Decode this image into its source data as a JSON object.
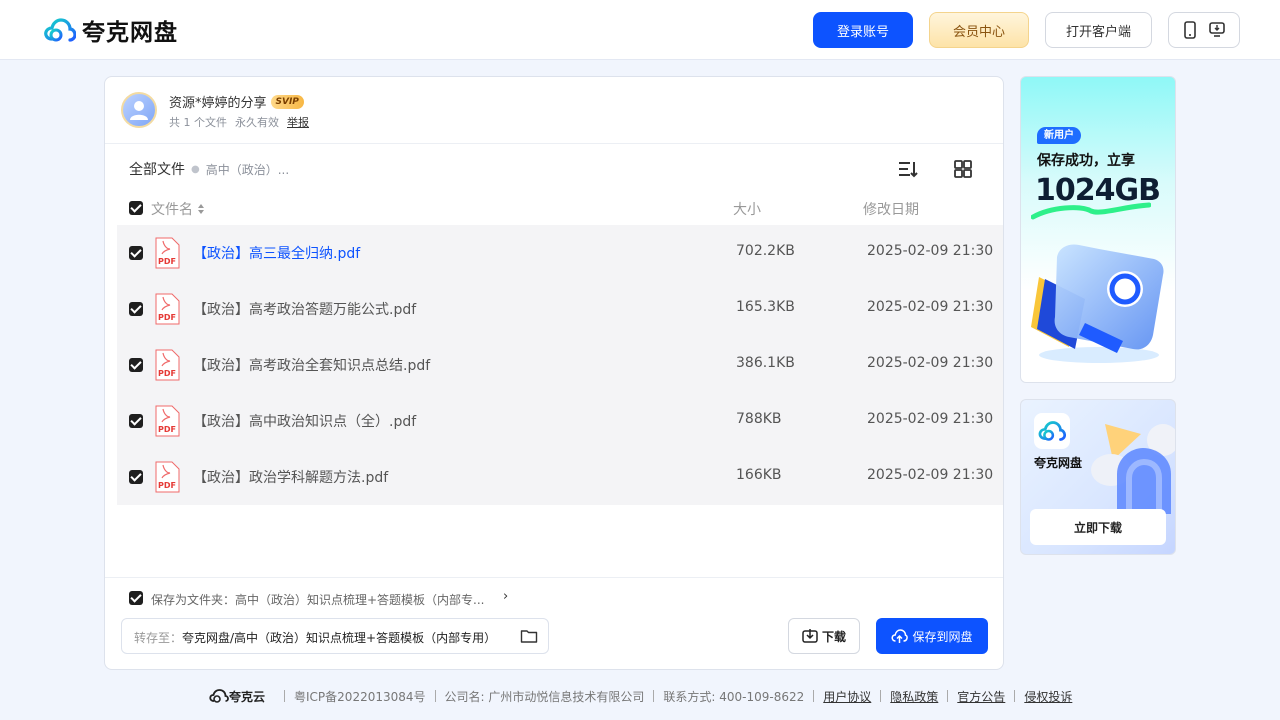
{
  "header": {
    "logo_text": "夸克网盘",
    "login_label": "登录账号",
    "vip_label": "会员中心",
    "client_label": "打开客户端"
  },
  "share": {
    "title": "资源*婷婷的分享",
    "badge": "SVIP",
    "file_count": "共 1 个文件",
    "validity": "永久有效",
    "report": "举报"
  },
  "breadcrumb": {
    "root": "全部文件",
    "current": "高中（政治）..."
  },
  "columns": {
    "name": "文件名",
    "size": "大小",
    "date": "修改日期"
  },
  "files": [
    {
      "name": "【政治】高三最全归纳.pdf",
      "size": "702.2KB",
      "date": "2025-02-09 21:30"
    },
    {
      "name": "【政治】高考政治答题万能公式.pdf",
      "size": "165.3KB",
      "date": "2025-02-09 21:30"
    },
    {
      "name": "【政治】高考政治全套知识点总结.pdf",
      "size": "386.1KB",
      "date": "2025-02-09 21:30"
    },
    {
      "name": "【政治】高中政治知识点（全）.pdf",
      "size": "788KB",
      "date": "2025-02-09 21:30"
    },
    {
      "name": "【政治】政治学科解题方法.pdf",
      "size": "166KB",
      "date": "2025-02-09 21:30"
    }
  ],
  "save_folder": {
    "label": "保存为文件夹：高中（政治）知识点梳理+答题模板（内部专...",
    "arrow": "›"
  },
  "destination": {
    "prefix": "转存至：",
    "path": "夸克网盘/高中（政治）知识点梳理+答题模板（内部专用）"
  },
  "actions": {
    "download": "下载",
    "save": "保存到网盘"
  },
  "ads": {
    "ad1_badge": "新用户",
    "ad1_title": "保存成功，立享",
    "ad1_amount": "1024GB",
    "ad2_name": "夸克网盘",
    "ad2_button": "立即下载"
  },
  "footer": {
    "brand": "夸克云",
    "icp": "粤ICP备2022013084号",
    "company": "公司名: 广州市动悦信息技术有限公司",
    "contact": "联系方式: 400-109-8622",
    "links": [
      "用户协议",
      "隐私政策",
      "官方公告",
      "侵权投诉"
    ]
  },
  "colors": {
    "accent": "#0d53ff",
    "page_bg": "#f1f5fd"
  }
}
